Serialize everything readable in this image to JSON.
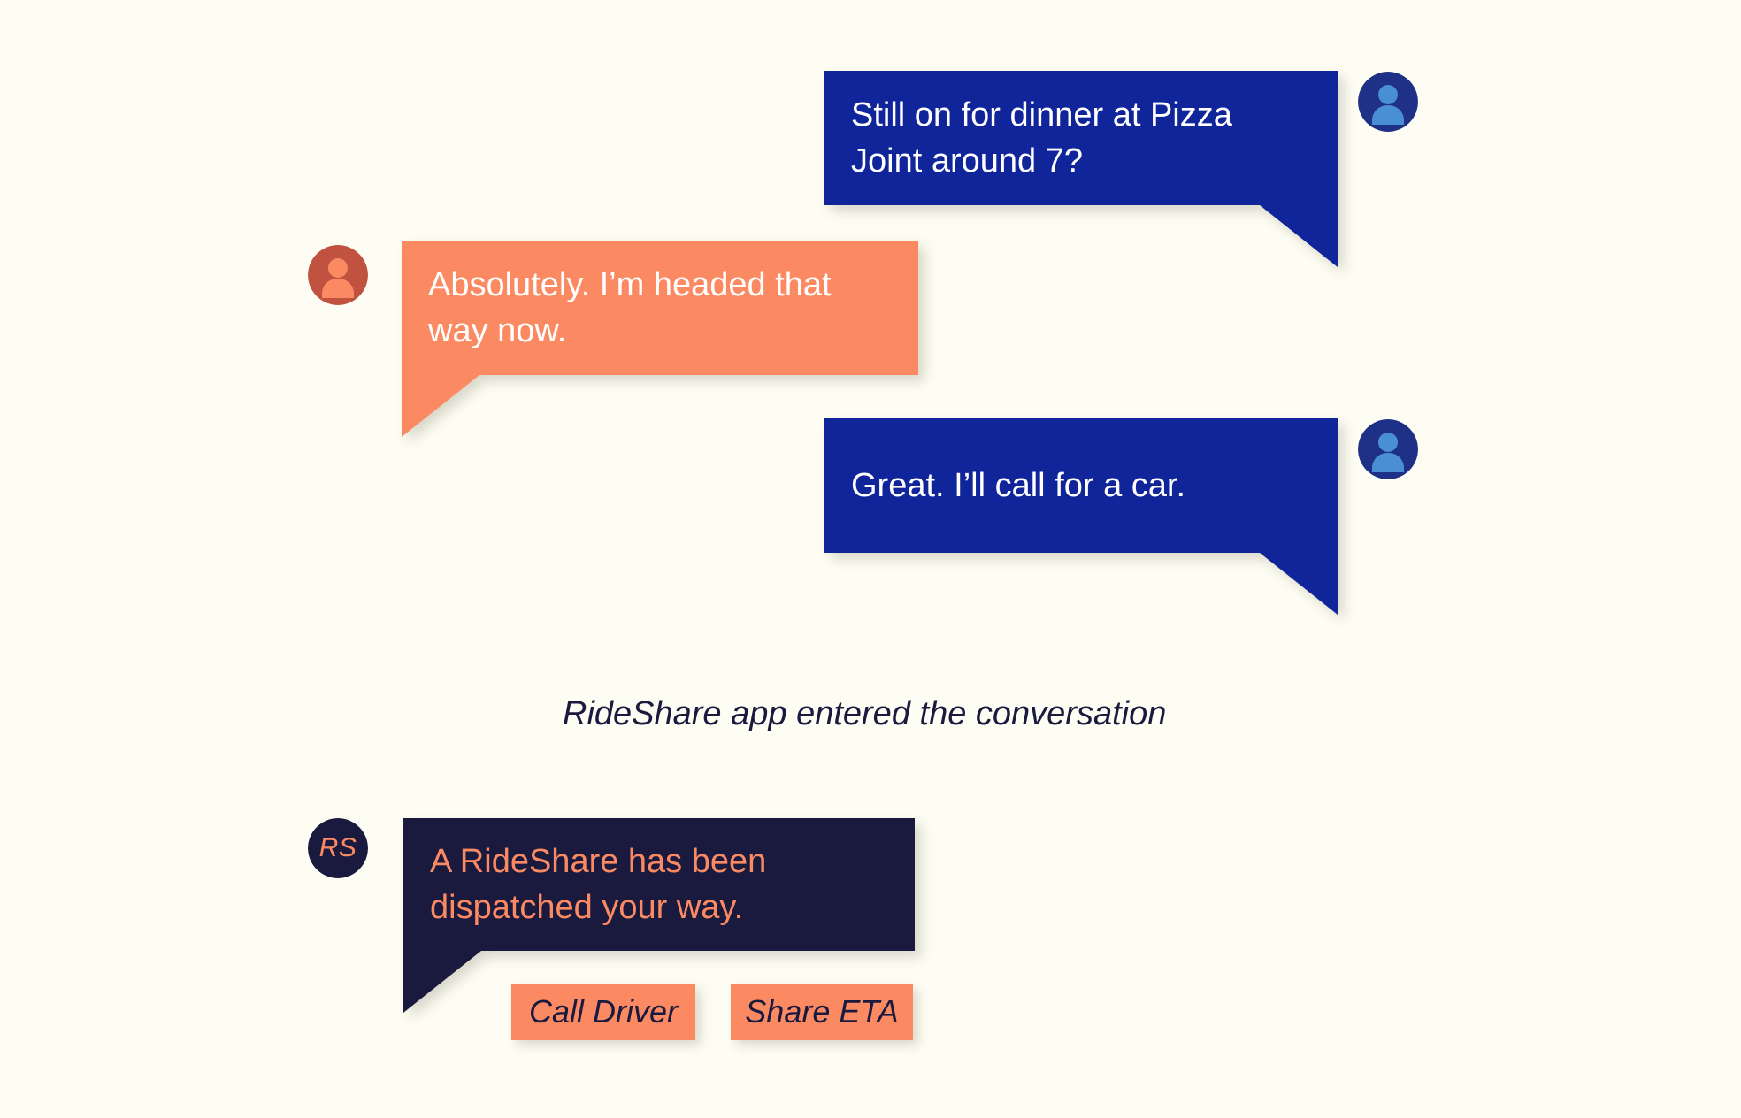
{
  "theme": {
    "background": "#fdfdf3",
    "blue": "#11259a",
    "blue_text": "#ffffff",
    "orange": "#fb8a63",
    "orange_text": "#ffffff",
    "navy": "#191a3e",
    "navy_text": "#fb8a63",
    "system_text": "#191a3e",
    "avatar_blue_ring": "#1f3087",
    "avatar_blue_glyph": "#4a8fd4",
    "avatar_red_ring": "#c0523f",
    "avatar_red_glyph": "#fb8a63",
    "button_bg": "#fb8a63",
    "button_text": "#191a3e"
  },
  "conversation": {
    "messages": [
      {
        "id": "msg-outgoing-dinner",
        "sender": "me",
        "side": "right",
        "text": "Still on for dinner at Pizza\nJoint around 7?",
        "avatar_icon": "person-avatar-icon"
      },
      {
        "id": "msg-incoming-headed",
        "sender": "friend",
        "side": "left",
        "text": "Absolutely. I’m headed that\nway now.",
        "avatar_icon": "person-avatar-icon"
      },
      {
        "id": "msg-outgoing-call-car",
        "sender": "me",
        "side": "right",
        "text": "Great. I’ll call for a car.",
        "avatar_icon": "person-avatar-icon"
      }
    ],
    "system_notice": "RideShare app entered the conversation",
    "app_message": {
      "id": "msg-app-dispatched",
      "sender": "RideShare app",
      "avatar_initials": "RS",
      "text": "A RideShare has been\ndispatched your way.",
      "quick_replies": [
        {
          "id": "call-driver",
          "label": "Call Driver"
        },
        {
          "id": "share-eta",
          "label": "Share ETA"
        }
      ]
    }
  }
}
